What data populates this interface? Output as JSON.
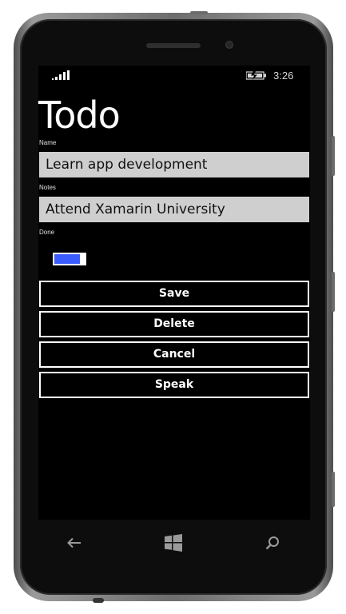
{
  "status_bar": {
    "signal_icon": "signal-strength-icon",
    "battery_icon": "battery-charging-icon",
    "time": "3:26"
  },
  "page": {
    "title": "Todo"
  },
  "form": {
    "name_label": "Name",
    "name_value": "Learn app development",
    "notes_label": "Notes",
    "notes_value": "Attend Xamarin University",
    "done_label": "Done",
    "done_on": true,
    "toggle_color": "#3b5cff"
  },
  "actions": {
    "save": "Save",
    "delete": "Delete",
    "cancel": "Cancel",
    "speak": "Speak"
  },
  "nav": {
    "back_icon": "back-arrow-icon",
    "start_icon": "windows-start-icon",
    "search_icon": "search-icon"
  }
}
